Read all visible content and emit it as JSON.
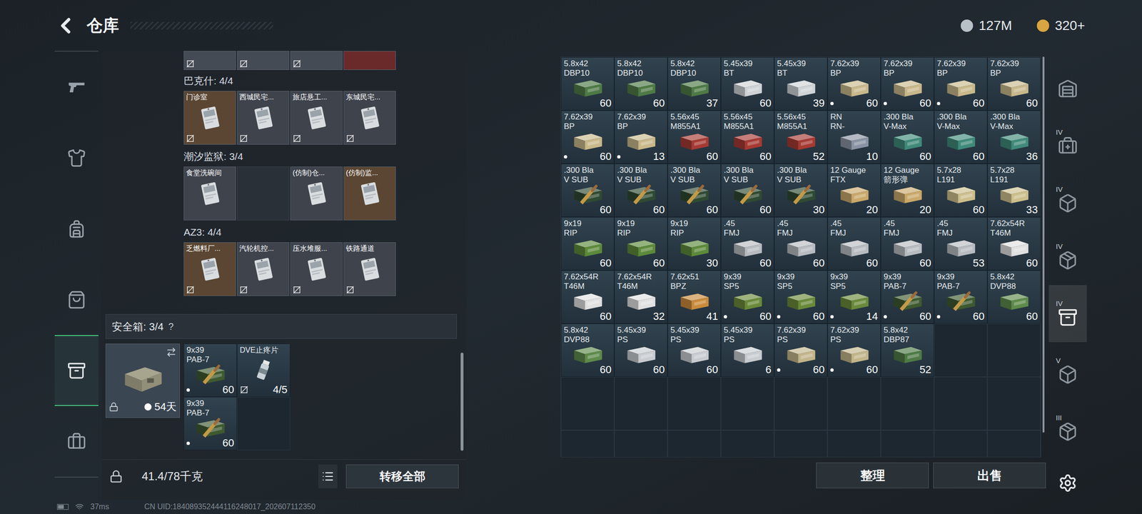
{
  "header": {
    "title": "仓库",
    "currencies": [
      {
        "amount": "127M",
        "color": "#b8c0c8"
      },
      {
        "amount": "320+",
        "color": "#d9a441"
      }
    ]
  },
  "sidebar": {
    "items": [
      {
        "kind": "pistol",
        "selected": false
      },
      {
        "kind": "vest",
        "selected": false
      },
      {
        "kind": "rig",
        "selected": false
      },
      {
        "kind": "backpack",
        "selected": false
      },
      {
        "kind": "container",
        "selected": true
      },
      {
        "kind": "case",
        "selected": false
      }
    ]
  },
  "top_partial_keys": [
    {
      "color": "#454b55",
      "untradable": true
    },
    {
      "color": "#454b55",
      "untradable": true
    },
    {
      "color": "#454b55",
      "untradable": true
    },
    {
      "color": "#6b2a2a",
      "untradable": false
    }
  ],
  "key_sections": [
    {
      "title": "巴克什: 4/4",
      "keys": [
        {
          "kind": "key",
          "label": "门诊室",
          "color": "#5a4632",
          "untradable": true
        },
        {
          "kind": "key",
          "label": "西城民宅...",
          "color": "#3e434c",
          "untradable": true
        },
        {
          "kind": "key",
          "label": "旅店悬工...",
          "color": "#3e434c",
          "untradable": true
        },
        {
          "kind": "key",
          "label": "东城民宅...",
          "color": "#3e434c",
          "untradable": true
        }
      ]
    },
    {
      "title": "潮汐监狱: 3/4",
      "keys": [
        {
          "kind": "key",
          "label": "食堂洗碗间",
          "color": "#3e434c",
          "untradable": false
        },
        {
          "kind": "empty",
          "label": "",
          "color": "#2a3038",
          "untradable": false
        },
        {
          "kind": "key",
          "label": "(仿制)仓...",
          "color": "#3e434c",
          "untradable": false
        },
        {
          "kind": "key",
          "label": "(仿制)监...",
          "color": "#5a4632",
          "untradable": false
        }
      ]
    },
    {
      "title": "AZ3: 4/4",
      "keys": [
        {
          "kind": "key",
          "label": "乏燃料厂...",
          "color": "#5a4632",
          "untradable": true
        },
        {
          "kind": "key",
          "label": "汽轮机控...",
          "color": "#3e434c",
          "untradable": true
        },
        {
          "kind": "key",
          "label": "压水堆服...",
          "color": "#3e434c",
          "untradable": true
        },
        {
          "kind": "key",
          "label": "铁路通道",
          "color": "#3e434c",
          "untradable": true
        }
      ]
    }
  ],
  "safe_box": {
    "title": "安全箱: 3/4",
    "help": "?",
    "days": "54天",
    "locked": true,
    "items": [
      {
        "kind": "round",
        "caliber": "9x39",
        "type": "PAB-7",
        "count": "60",
        "marked": true,
        "color": "#3e5a30"
      },
      {
        "kind": "med",
        "name": "DVE止疼片",
        "count": "4/5",
        "untradable": true
      },
      {
        "kind": "round",
        "caliber": "9x39",
        "type": "PAB-7",
        "count": "60",
        "marked": true,
        "color": "#3e5a30"
      },
      {
        "kind": "empty"
      }
    ]
  },
  "weight": "41.4/78千克",
  "transfer_button": "转移全部",
  "stash": {
    "items": [
      {
        "kind": "box",
        "caliber": "5.8x42",
        "type": "DBP10",
        "count": "60",
        "marked": false,
        "color": "#4e7a45"
      },
      {
        "kind": "box",
        "caliber": "5.8x42",
        "type": "DBP10",
        "count": "60",
        "marked": false,
        "color": "#4e7a45"
      },
      {
        "kind": "box",
        "caliber": "5.8x42",
        "type": "DBP10",
        "count": "37",
        "marked": false,
        "color": "#4e7a45"
      },
      {
        "kind": "box",
        "caliber": "5.45x39",
        "type": "BT",
        "count": "60",
        "marked": false,
        "color": "#cfd3d6"
      },
      {
        "kind": "box",
        "caliber": "5.45x39",
        "type": "BT",
        "count": "39",
        "marked": false,
        "color": "#cfd3d6"
      },
      {
        "kind": "box",
        "caliber": "7.62x39",
        "type": "BP",
        "count": "60",
        "marked": true,
        "color": "#c8b88a"
      },
      {
        "kind": "box",
        "caliber": "7.62x39",
        "type": "BP",
        "count": "60",
        "marked": true,
        "color": "#c8b88a"
      },
      {
        "kind": "box",
        "caliber": "7.62x39",
        "type": "BP",
        "count": "60",
        "marked": true,
        "color": "#c8b88a"
      },
      {
        "kind": "box",
        "caliber": "7.62x39",
        "type": "BP",
        "count": "60",
        "marked": false,
        "color": "#c8b88a"
      },
      {
        "kind": "box",
        "caliber": "7.62x39",
        "type": "BP",
        "count": "60",
        "marked": true,
        "color": "#c8b88a"
      },
      {
        "kind": "box",
        "caliber": "7.62x39",
        "type": "BP",
        "count": "13",
        "marked": true,
        "color": "#c8b88a"
      },
      {
        "kind": "box",
        "caliber": "5.56x45",
        "type": "M855A1",
        "count": "60",
        "marked": false,
        "color": "#a63a33"
      },
      {
        "kind": "box",
        "caliber": "5.56x45",
        "type": "M855A1",
        "count": "60",
        "marked": false,
        "color": "#a63a33"
      },
      {
        "kind": "box",
        "caliber": "5.56x45",
        "type": "M855A1",
        "count": "52",
        "marked": false,
        "color": "#a63a33"
      },
      {
        "kind": "box",
        "caliber": "RN",
        "type": "RN-",
        "count": "10",
        "marked": false,
        "color": "#8a93a3"
      },
      {
        "kind": "box",
        "caliber": ".300 Bla",
        "type": "V-Max",
        "count": "60",
        "marked": false,
        "color": "#3f8a7a"
      },
      {
        "kind": "box",
        "caliber": ".300 Bla",
        "type": "V-Max",
        "count": "60",
        "marked": false,
        "color": "#3f8a7a"
      },
      {
        "kind": "box",
        "caliber": ".300 Bla",
        "type": "V-Max",
        "count": "36",
        "marked": false,
        "color": "#3f8a7a"
      },
      {
        "kind": "round",
        "caliber": ".300 Bla",
        "type": "V SUB",
        "count": "60",
        "marked": false,
        "color": "#2f4a32"
      },
      {
        "kind": "round",
        "caliber": ".300 Bla",
        "type": "V SUB",
        "count": "60",
        "marked": false,
        "color": "#2f4a32"
      },
      {
        "kind": "round",
        "caliber": ".300 Bla",
        "type": "V SUB",
        "count": "60",
        "marked": false,
        "color": "#2f4a32"
      },
      {
        "kind": "round",
        "caliber": ".300 Bla",
        "type": "V SUB",
        "count": "60",
        "marked": false,
        "color": "#2f4a32"
      },
      {
        "kind": "round",
        "caliber": ".300 Bla",
        "type": "V SUB",
        "count": "30",
        "marked": false,
        "color": "#2f4a32"
      },
      {
        "kind": "box",
        "caliber": "12 Gauge",
        "type": "FTX",
        "count": "20",
        "marked": false,
        "color": "#c9a86a"
      },
      {
        "kind": "box",
        "caliber": "12 Gauge",
        "type": "箭形弹",
        "count": "20",
        "marked": false,
        "color": "#c9a86a"
      },
      {
        "kind": "box",
        "caliber": "5.7x28",
        "type": "L191",
        "count": "60",
        "marked": false,
        "color": "#cdbf8c"
      },
      {
        "kind": "box",
        "caliber": "5.7x28",
        "type": "L191",
        "count": "33",
        "marked": false,
        "color": "#cdbf8c"
      },
      {
        "kind": "box",
        "caliber": "9x19",
        "type": "RIP",
        "count": "60",
        "marked": false,
        "color": "#5c8a3a"
      },
      {
        "kind": "box",
        "caliber": "9x19",
        "type": "RIP",
        "count": "60",
        "marked": false,
        "color": "#5c8a3a"
      },
      {
        "kind": "box",
        "caliber": "9x19",
        "type": "RIP",
        "count": "30",
        "marked": false,
        "color": "#5c8a3a"
      },
      {
        "kind": "box",
        "caliber": ".45",
        "type": "FMJ",
        "count": "60",
        "marked": false,
        "color": "#b8bcc0"
      },
      {
        "kind": "box",
        "caliber": ".45",
        "type": "FMJ",
        "count": "60",
        "marked": false,
        "color": "#b8bcc0"
      },
      {
        "kind": "box",
        "caliber": ".45",
        "type": "FMJ",
        "count": "60",
        "marked": false,
        "color": "#b8bcc0"
      },
      {
        "kind": "box",
        "caliber": ".45",
        "type": "FMJ",
        "count": "60",
        "marked": false,
        "color": "#b8bcc0"
      },
      {
        "kind": "box",
        "caliber": ".45",
        "type": "FMJ",
        "count": "53",
        "marked": false,
        "color": "#b8bcc0"
      },
      {
        "kind": "box",
        "caliber": "7.62x54R",
        "type": "T46M",
        "count": "60",
        "marked": false,
        "color": "#e0e0e0"
      },
      {
        "kind": "box",
        "caliber": "7.62x54R",
        "type": "T46M",
        "count": "60",
        "marked": false,
        "color": "#e0e0e0"
      },
      {
        "kind": "box",
        "caliber": "7.62x54R",
        "type": "T46M",
        "count": "32",
        "marked": false,
        "color": "#e0e0e0"
      },
      {
        "kind": "box",
        "caliber": "7.62x51",
        "type": "BPZ",
        "count": "41",
        "marked": false,
        "color": "#c98a3a"
      },
      {
        "kind": "box",
        "caliber": "9x39",
        "type": "SP5",
        "count": "60",
        "marked": true,
        "color": "#6a8a3a"
      },
      {
        "kind": "box",
        "caliber": "9x39",
        "type": "SP5",
        "count": "60",
        "marked": true,
        "color": "#6a8a3a"
      },
      {
        "kind": "box",
        "caliber": "9x39",
        "type": "SP5",
        "count": "14",
        "marked": true,
        "color": "#6a8a3a"
      },
      {
        "kind": "round",
        "caliber": "9x39",
        "type": "PAB-7",
        "count": "60",
        "marked": true,
        "color": "#3e5a30"
      },
      {
        "kind": "round",
        "caliber": "9x39",
        "type": "PAB-7",
        "count": "60",
        "marked": true,
        "color": "#3e5a30"
      },
      {
        "kind": "box",
        "caliber": "5.8x42",
        "type": "DVP88",
        "count": "60",
        "marked": false,
        "color": "#5e8a4a"
      },
      {
        "kind": "box",
        "caliber": "5.8x42",
        "type": "DVP88",
        "count": "60",
        "marked": false,
        "color": "#5e8a4a"
      },
      {
        "kind": "box",
        "caliber": "5.45x39",
        "type": "PS",
        "count": "60",
        "marked": false,
        "color": "#c8ccd0"
      },
      {
        "kind": "box",
        "caliber": "5.45x39",
        "type": "PS",
        "count": "60",
        "marked": false,
        "color": "#c8ccd0"
      },
      {
        "kind": "box",
        "caliber": "5.45x39",
        "type": "PS",
        "count": "6",
        "marked": false,
        "color": "#c8ccd0"
      },
      {
        "kind": "box",
        "caliber": "7.62x39",
        "type": "PS",
        "count": "60",
        "marked": true,
        "color": "#c2b58a"
      },
      {
        "kind": "box",
        "caliber": "7.62x39",
        "type": "PS",
        "count": "60",
        "marked": true,
        "color": "#c2b58a"
      },
      {
        "kind": "box",
        "caliber": "5.8x42",
        "type": "DBP87",
        "count": "52",
        "marked": false,
        "color": "#4e7a45"
      }
    ]
  },
  "stash_buttons": [
    "整理",
    "出售"
  ],
  "stash_tabs": [
    {
      "label": "",
      "kind": "stash",
      "selected": false
    },
    {
      "label": "IV",
      "kind": "medical",
      "selected": false
    },
    {
      "label": "IV",
      "kind": "box",
      "selected": false
    },
    {
      "label": "IV",
      "kind": "crate",
      "selected": false
    },
    {
      "label": "IV",
      "kind": "files",
      "selected": true
    },
    {
      "label": "V",
      "kind": "box",
      "selected": false
    },
    {
      "label": "III",
      "kind": "crate",
      "selected": false
    }
  ],
  "status_bar": {
    "battery_level": 0.6,
    "ping": "37ms",
    "uid": "CN UID:184089352444116248017_202607112350"
  }
}
